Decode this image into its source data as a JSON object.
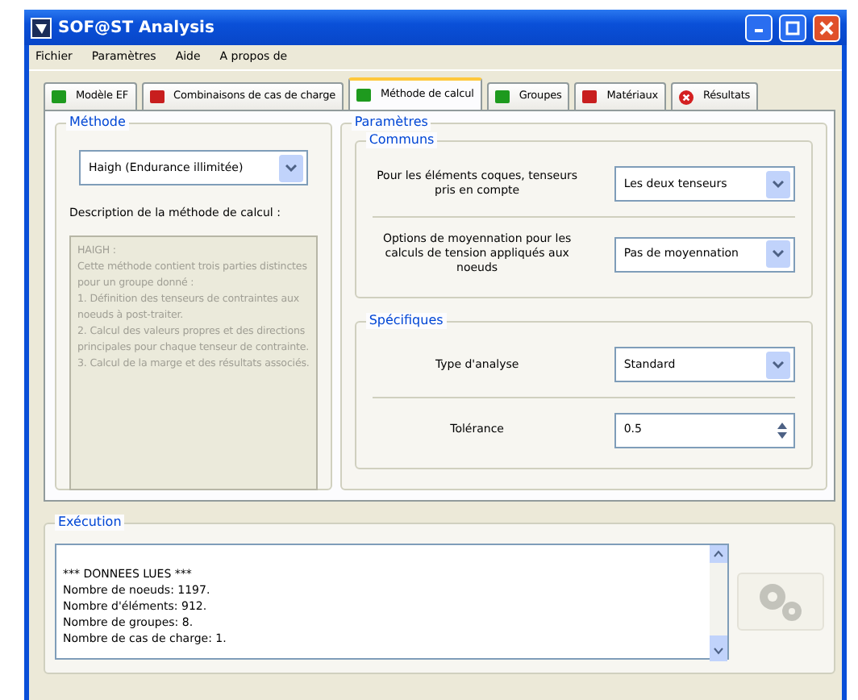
{
  "window": {
    "title": "SOF@ST Analysis"
  },
  "menu": [
    "Fichier",
    "Paramètres",
    "Aide",
    "A propos de"
  ],
  "tabs": [
    {
      "label": "Modèle EF",
      "kind": "square",
      "color": "#1e9a1e",
      "selected": false
    },
    {
      "label": "Combinaisons de cas de charge",
      "kind": "square",
      "color": "#c81e1e",
      "selected": false
    },
    {
      "label": "Méthode de calcul",
      "kind": "square",
      "color": "#1e9a1e",
      "selected": true
    },
    {
      "label": "Groupes",
      "kind": "square",
      "color": "#1e9a1e",
      "selected": false
    },
    {
      "label": "Matériaux",
      "kind": "square",
      "color": "#c81e1e",
      "selected": false
    },
    {
      "label": "Résultats",
      "kind": "error",
      "selected": false
    }
  ],
  "method": {
    "title": "Méthode",
    "value": "Haigh (Endurance illimitée)",
    "description_label": "Description de la méthode de calcul :",
    "description": [
      "HAIGH :",
      "Cette méthode contient trois parties distinctes",
      "pour un groupe donné :",
      "1. Définition des tenseurs de contraintes aux",
      "noeuds à post-traiter.",
      "2. Calcul des valeurs propres et des directions",
      "principales pour chaque tenseur de contrainte.",
      "3. Calcul de la marge et des résultats associés."
    ]
  },
  "parameters": {
    "title": "Paramètres",
    "groups": [
      {
        "title": "Communs",
        "rows": [
          {
            "label": "Pour les éléments coques, tenseurs pris en compte",
            "kind": "combo",
            "value": "Les deux tenseurs"
          },
          {
            "label": "Options de moyennation pour les calculs de tension appliqués aux noeuds",
            "kind": "combo",
            "value": "Pas de moyennation"
          }
        ]
      },
      {
        "title": "Spécifiques",
        "rows": [
          {
            "label": "Type d'analyse",
            "kind": "combo",
            "value": "Standard"
          },
          {
            "label": "Tolérance",
            "kind": "spin",
            "value": "0.5"
          }
        ]
      }
    ]
  },
  "execution": {
    "title": "Exécution",
    "log": [
      "*** DONNEES LUES ***",
      "Nombre de noeuds: 1197.",
      "Nombre d'éléments: 912.",
      "Nombre de groupes: 8.",
      "Nombre de cas de charge: 1."
    ],
    "run_disabled": true
  }
}
